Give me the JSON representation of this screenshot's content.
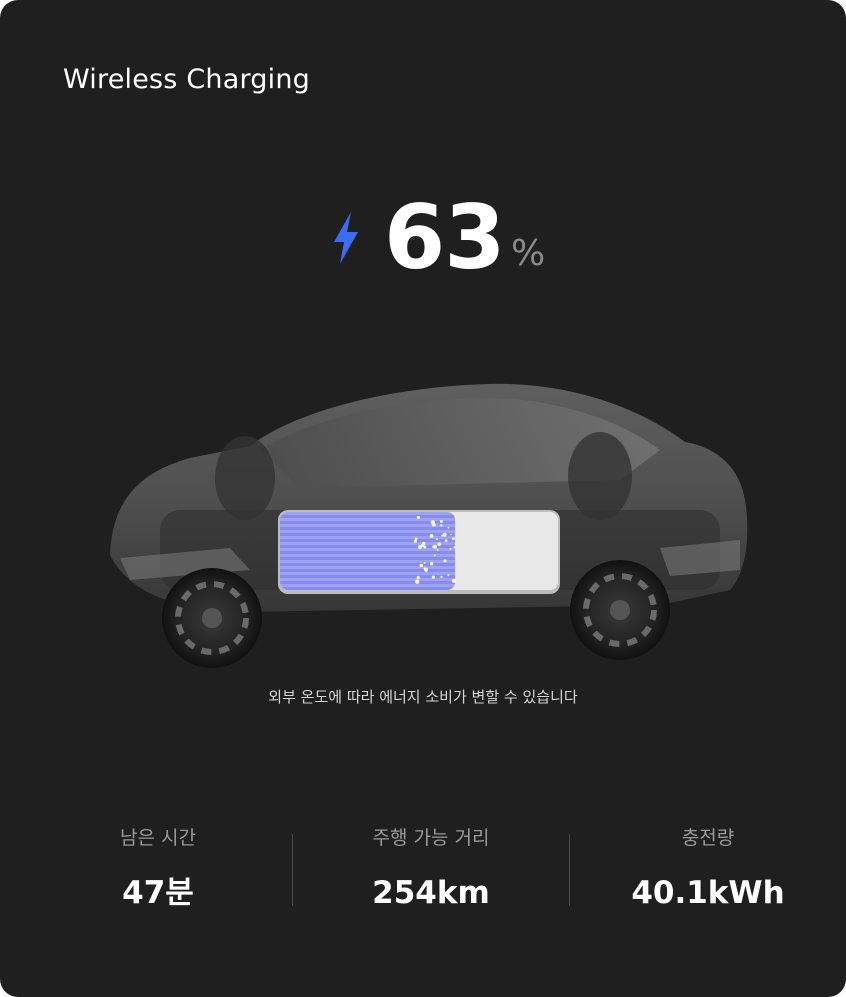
{
  "header": {
    "title": "Wireless Charging"
  },
  "charge": {
    "percent_value": "63",
    "percent_unit": "%",
    "battery_level": 0.63,
    "bolt_color": "#3b6cf2",
    "battery_fill_color": "#8b90ef"
  },
  "note": "외부 온도에 따라 에너지 소비가 변할 수 있습니다",
  "stats": [
    {
      "label": "남은 시간",
      "value": "47분"
    },
    {
      "label": "주행 가능 거리",
      "value": "254km"
    },
    {
      "label": "충전량",
      "value": "40.1kWh"
    }
  ],
  "icons": {
    "charging": "lightning-bolt-icon"
  }
}
